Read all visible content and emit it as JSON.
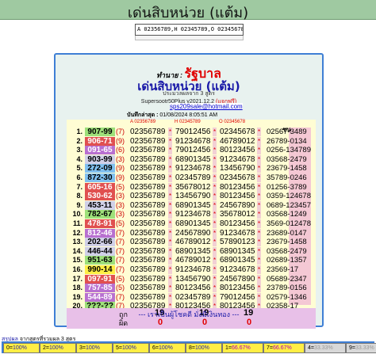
{
  "header": {
    "title": "เด่นสิบหน่วย (แต้ม)"
  },
  "input": {
    "value": "A 02356789,H 02345789,O 02345678"
  },
  "panel": {
    "sort_label": "ทำนาย :",
    "sort_value": "รัฐบาล",
    "title": "เด่นสิบหน่วย (แต้ม)",
    "subtitle": "ประมวลผลจาก 3 สูตร",
    "version": "Supersootr50Plus v2021.12.2",
    "version_tag": "(แจกฟรี)",
    "email": "sps209sale@hotmail.com",
    "date_label": "บันทึกล่าสุด :",
    "date_value": "01/08/2024 8:05:51 AM",
    "col_heads": [
      "A 02356789",
      "H 02345789",
      "O 02345678"
    ],
    "win_head": "ชน",
    "rows": [
      {
        "n": "1.",
        "pair": "907-99",
        "cnt": "(7)",
        "a": "02356789",
        "h": "79012456",
        "o": "02345678",
        "res": "02567-3489",
        "color": "#9ee07a"
      },
      {
        "n": "2.",
        "pair": "906-71",
        "cnt": "(9)",
        "a": "02356789",
        "h": "91234678",
        "o": "46789012",
        "res": "26789-0134",
        "color": "#e05050"
      },
      {
        "n": "3.",
        "pair": "091-65",
        "cnt": "(6)",
        "a": "02356789",
        "h": "79012456",
        "o": "80123456",
        "res": "0256-134789",
        "color": "#b870d0"
      },
      {
        "n": "4.",
        "pair": "903-99",
        "cnt": "(3)",
        "a": "02356789",
        "h": "68901345",
        "o": "91234678",
        "res": "03568-2479",
        "color": "#d0d0e8"
      },
      {
        "n": "5.",
        "pair": "272-09",
        "cnt": "(9)",
        "a": "02356789",
        "h": "91234678",
        "o": "13456790",
        "res": "23679-1458",
        "color": "#80c0f0"
      },
      {
        "n": "6.",
        "pair": "872-30",
        "cnt": "(9)",
        "a": "02356789",
        "h": "02345789",
        "o": "02345678",
        "res": "35789-0246",
        "color": "#80c0f0"
      },
      {
        "n": "7.",
        "pair": "605-16",
        "cnt": "(5)",
        "a": "02356789",
        "h": "35678012",
        "o": "80123456",
        "res": "01256-3789",
        "color": "#e05050"
      },
      {
        "n": "8.",
        "pair": "530-62",
        "cnt": "(3)",
        "a": "02356789",
        "h": "13456790",
        "o": "80123456",
        "res": "0359-124678",
        "color": "#e05050"
      },
      {
        "n": "9.",
        "pair": "453-11",
        "cnt": "(3)",
        "a": "02356789",
        "h": "68901345",
        "o": "24567890",
        "res": "0689-123457",
        "color": "#d0d0e8"
      },
      {
        "n": "10.",
        "pair": "782-67",
        "cnt": "(3)",
        "a": "02356789",
        "h": "91234678",
        "o": "35678012",
        "res": "03568-1249",
        "color": "#9ee07a"
      },
      {
        "n": "11.",
        "pair": "478-91",
        "cnt": "(5)",
        "a": "02356789",
        "h": "68901345",
        "o": "80123456",
        "res": "3569-012478",
        "color": "#e05050"
      },
      {
        "n": "12.",
        "pair": "812-46",
        "cnt": "(7)",
        "a": "02356789",
        "h": "24567890",
        "o": "91234678",
        "res": "23689-0147",
        "color": "#b870d0"
      },
      {
        "n": "13.",
        "pair": "202-66",
        "cnt": "(7)",
        "a": "02356789",
        "h": "46789012",
        "o": "57890123",
        "res": "23679-1458",
        "color": "#d0d0e8"
      },
      {
        "n": "14.",
        "pair": "446-44",
        "cnt": "(7)",
        "a": "02356789",
        "h": "68901345",
        "o": "68901345",
        "res": "03568-2479",
        "color": "#d0d0e8"
      },
      {
        "n": "15.",
        "pair": "951-63",
        "cnt": "(7)",
        "a": "02356789",
        "h": "46789012",
        "o": "68901345",
        "res": "02689-1357",
        "color": "#9ee07a"
      },
      {
        "n": "16.",
        "pair": "990-14",
        "cnt": "(7)",
        "a": "02356789",
        "h": "91234678",
        "o": "91234678",
        "res": "23569-17",
        "color": "#ffee44"
      },
      {
        "n": "17.",
        "pair": "097-91",
        "cnt": "(5)",
        "a": "02356789",
        "h": "13456790",
        "o": "24567890",
        "res": "05689-2347",
        "color": "#e05050"
      },
      {
        "n": "18.",
        "pair": "757-85",
        "cnt": "(5)",
        "a": "02356789",
        "h": "80123456",
        "o": "80123456",
        "res": "23789-0156",
        "color": "#b870d0"
      },
      {
        "n": "19.",
        "pair": "544-89",
        "cnt": "(7)",
        "a": "02356789",
        "h": "02345789",
        "o": "79012456",
        "res": "02579-1346",
        "color": "#b870d0"
      },
      {
        "n": "20.",
        "pair": "???-??",
        "cnt": "(7)",
        "a": "02356789",
        "h": "80123456",
        "o": "80123456",
        "res": "02358-17",
        "color": "#9ee07a"
      }
    ],
    "foot": {
      "right_label": "ถูก",
      "wrong_label": "ผิด",
      "a_right": "19",
      "a_wrong": "0",
      "h_right": "19",
      "h_wrong": "0",
      "o_right": "19",
      "o_wrong": "0"
    },
    "message": "--- เราเป็นผู้โชคดี มั่งมีเงินทอง ---"
  },
  "summary": {
    "title": "สรุปผล",
    "subtitle": "จากสูตรที่รวมผล 3 สูตร",
    "chips": [
      {
        "k": "0=",
        "pct": "100%",
        "style": "y"
      },
      {
        "k": "2=",
        "pct": "100%",
        "style": "y"
      },
      {
        "k": "3=",
        "pct": "100%",
        "style": "y"
      },
      {
        "k": "5=",
        "pct": "100%",
        "style": "y"
      },
      {
        "k": "6=",
        "pct": "100%",
        "style": "y"
      },
      {
        "k": "8=",
        "pct": "100%",
        "style": "y"
      },
      {
        "k": "1=",
        "pct": "66.67%",
        "style": "m"
      },
      {
        "k": "7=",
        "pct": "66.67%",
        "style": "m"
      },
      {
        "k": "4=",
        "pct": "33.33%",
        "style": "g"
      },
      {
        "k": "9=",
        "pct": "33.33%",
        "style": "g"
      }
    ]
  }
}
